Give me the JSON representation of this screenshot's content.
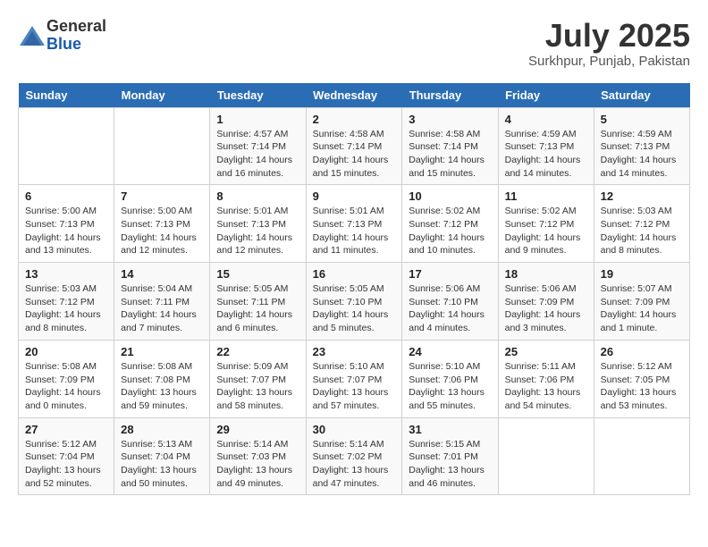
{
  "header": {
    "logo_general": "General",
    "logo_blue": "Blue",
    "title": "July 2025",
    "location": "Surkhpur, Punjab, Pakistan"
  },
  "days_of_week": [
    "Sunday",
    "Monday",
    "Tuesday",
    "Wednesday",
    "Thursday",
    "Friday",
    "Saturday"
  ],
  "weeks": [
    [
      {
        "day": "",
        "info": ""
      },
      {
        "day": "",
        "info": ""
      },
      {
        "day": "1",
        "info": "Sunrise: 4:57 AM\nSunset: 7:14 PM\nDaylight: 14 hours\nand 16 minutes."
      },
      {
        "day": "2",
        "info": "Sunrise: 4:58 AM\nSunset: 7:14 PM\nDaylight: 14 hours\nand 15 minutes."
      },
      {
        "day": "3",
        "info": "Sunrise: 4:58 AM\nSunset: 7:14 PM\nDaylight: 14 hours\nand 15 minutes."
      },
      {
        "day": "4",
        "info": "Sunrise: 4:59 AM\nSunset: 7:13 PM\nDaylight: 14 hours\nand 14 minutes."
      },
      {
        "day": "5",
        "info": "Sunrise: 4:59 AM\nSunset: 7:13 PM\nDaylight: 14 hours\nand 14 minutes."
      }
    ],
    [
      {
        "day": "6",
        "info": "Sunrise: 5:00 AM\nSunset: 7:13 PM\nDaylight: 14 hours\nand 13 minutes."
      },
      {
        "day": "7",
        "info": "Sunrise: 5:00 AM\nSunset: 7:13 PM\nDaylight: 14 hours\nand 12 minutes."
      },
      {
        "day": "8",
        "info": "Sunrise: 5:01 AM\nSunset: 7:13 PM\nDaylight: 14 hours\nand 12 minutes."
      },
      {
        "day": "9",
        "info": "Sunrise: 5:01 AM\nSunset: 7:13 PM\nDaylight: 14 hours\nand 11 minutes."
      },
      {
        "day": "10",
        "info": "Sunrise: 5:02 AM\nSunset: 7:12 PM\nDaylight: 14 hours\nand 10 minutes."
      },
      {
        "day": "11",
        "info": "Sunrise: 5:02 AM\nSunset: 7:12 PM\nDaylight: 14 hours\nand 9 minutes."
      },
      {
        "day": "12",
        "info": "Sunrise: 5:03 AM\nSunset: 7:12 PM\nDaylight: 14 hours\nand 8 minutes."
      }
    ],
    [
      {
        "day": "13",
        "info": "Sunrise: 5:03 AM\nSunset: 7:12 PM\nDaylight: 14 hours\nand 8 minutes."
      },
      {
        "day": "14",
        "info": "Sunrise: 5:04 AM\nSunset: 7:11 PM\nDaylight: 14 hours\nand 7 minutes."
      },
      {
        "day": "15",
        "info": "Sunrise: 5:05 AM\nSunset: 7:11 PM\nDaylight: 14 hours\nand 6 minutes."
      },
      {
        "day": "16",
        "info": "Sunrise: 5:05 AM\nSunset: 7:10 PM\nDaylight: 14 hours\nand 5 minutes."
      },
      {
        "day": "17",
        "info": "Sunrise: 5:06 AM\nSunset: 7:10 PM\nDaylight: 14 hours\nand 4 minutes."
      },
      {
        "day": "18",
        "info": "Sunrise: 5:06 AM\nSunset: 7:09 PM\nDaylight: 14 hours\nand 3 minutes."
      },
      {
        "day": "19",
        "info": "Sunrise: 5:07 AM\nSunset: 7:09 PM\nDaylight: 14 hours\nand 1 minute."
      }
    ],
    [
      {
        "day": "20",
        "info": "Sunrise: 5:08 AM\nSunset: 7:09 PM\nDaylight: 14 hours\nand 0 minutes."
      },
      {
        "day": "21",
        "info": "Sunrise: 5:08 AM\nSunset: 7:08 PM\nDaylight: 13 hours\nand 59 minutes."
      },
      {
        "day": "22",
        "info": "Sunrise: 5:09 AM\nSunset: 7:07 PM\nDaylight: 13 hours\nand 58 minutes."
      },
      {
        "day": "23",
        "info": "Sunrise: 5:10 AM\nSunset: 7:07 PM\nDaylight: 13 hours\nand 57 minutes."
      },
      {
        "day": "24",
        "info": "Sunrise: 5:10 AM\nSunset: 7:06 PM\nDaylight: 13 hours\nand 55 minutes."
      },
      {
        "day": "25",
        "info": "Sunrise: 5:11 AM\nSunset: 7:06 PM\nDaylight: 13 hours\nand 54 minutes."
      },
      {
        "day": "26",
        "info": "Sunrise: 5:12 AM\nSunset: 7:05 PM\nDaylight: 13 hours\nand 53 minutes."
      }
    ],
    [
      {
        "day": "27",
        "info": "Sunrise: 5:12 AM\nSunset: 7:04 PM\nDaylight: 13 hours\nand 52 minutes."
      },
      {
        "day": "28",
        "info": "Sunrise: 5:13 AM\nSunset: 7:04 PM\nDaylight: 13 hours\nand 50 minutes."
      },
      {
        "day": "29",
        "info": "Sunrise: 5:14 AM\nSunset: 7:03 PM\nDaylight: 13 hours\nand 49 minutes."
      },
      {
        "day": "30",
        "info": "Sunrise: 5:14 AM\nSunset: 7:02 PM\nDaylight: 13 hours\nand 47 minutes."
      },
      {
        "day": "31",
        "info": "Sunrise: 5:15 AM\nSunset: 7:01 PM\nDaylight: 13 hours\nand 46 minutes."
      },
      {
        "day": "",
        "info": ""
      },
      {
        "day": "",
        "info": ""
      }
    ]
  ]
}
